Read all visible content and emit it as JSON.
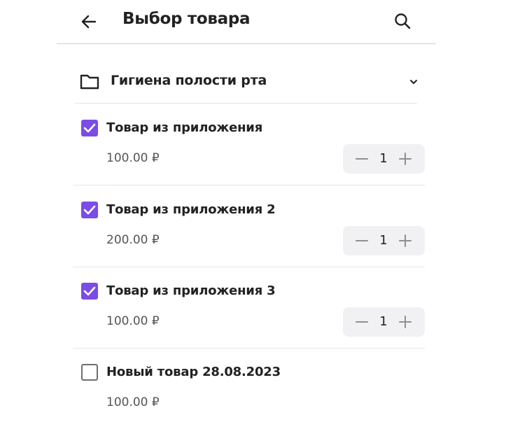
{
  "header": {
    "title": "Выбор товара",
    "back_icon": "arrow-left-icon",
    "search_icon": "search-icon"
  },
  "category": {
    "label": "Гигиена полости рта",
    "icon": "folder-icon",
    "expand_icon": "chevron-down-icon",
    "expanded": true
  },
  "products": [
    {
      "name": "Товар из приложения",
      "price": "100.00 ₽",
      "checked": true,
      "quantity": "1"
    },
    {
      "name": "Товар из приложения 2",
      "price": "200.00 ₽",
      "checked": true,
      "quantity": "1"
    },
    {
      "name": "Товар из приложения 3",
      "price": "100.00 ₽",
      "checked": true,
      "quantity": "1"
    },
    {
      "name": "Новый товар 28.08.2023",
      "price": "100.00 ₽",
      "checked": false
    }
  ],
  "colors": {
    "accent": "#7b4ce6",
    "stepper_bg": "#f1f1f4",
    "divider": "#e6e6e6"
  }
}
